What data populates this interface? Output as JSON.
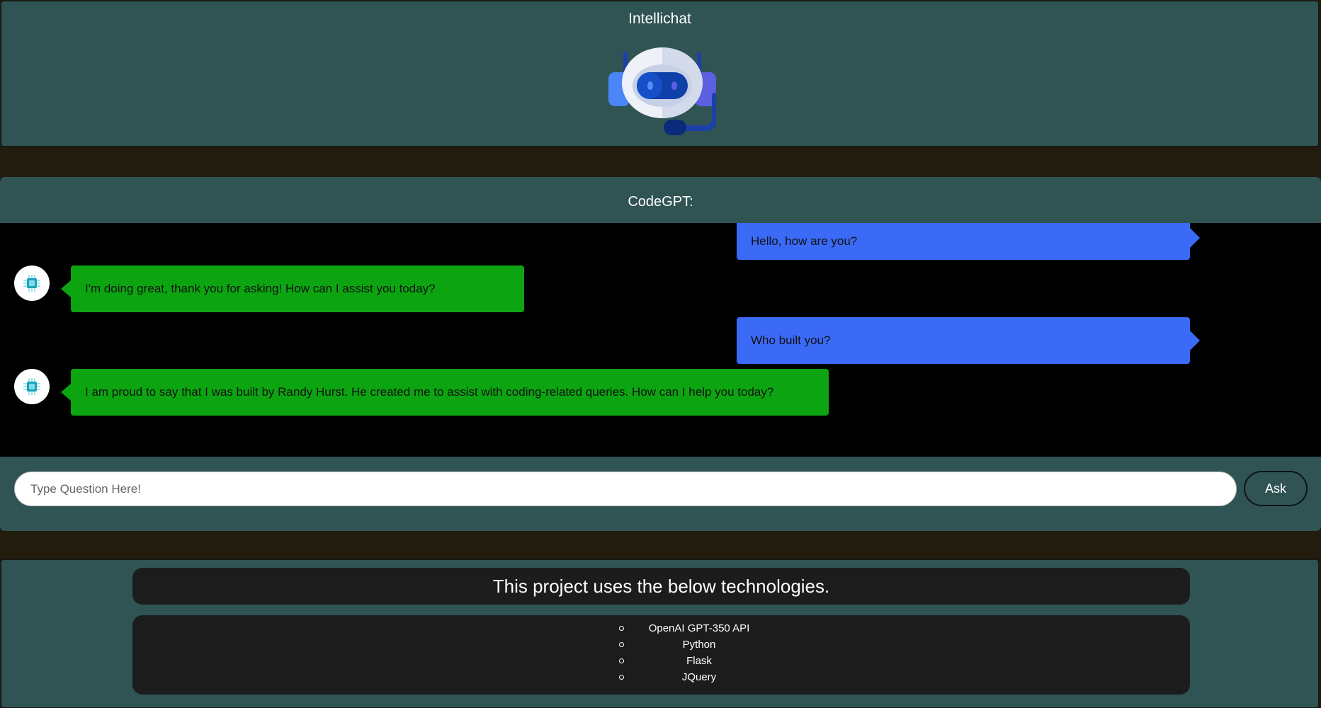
{
  "header": {
    "title": "Intellichat",
    "logo_icon": "robot-headset-icon"
  },
  "chat": {
    "title": "CodeGPT:",
    "bot_avatar_icon": "chip-icon",
    "messages": [
      {
        "role": "user",
        "text": "Hello, how are you?"
      },
      {
        "role": "bot",
        "text": "I'm doing great, thank you for asking! How can I assist you today?"
      },
      {
        "role": "user",
        "text": "Who built you?"
      },
      {
        "role": "bot",
        "text": "I am proud to say that I was built by Randy Hurst. He created me to assist with coding-related queries. How can I help you today?"
      }
    ],
    "input": {
      "placeholder": "Type Question Here!",
      "value": ""
    },
    "ask_label": "Ask"
  },
  "footer": {
    "heading": "This project uses the below technologies.",
    "technologies": [
      "OpenAI GPT-350 API",
      "Python",
      "Flask",
      "JQuery"
    ]
  },
  "colors": {
    "panel": "#305353",
    "page_background": "#221c0e",
    "chat_background": "#000000",
    "user_bubble": "#3a6af6",
    "bot_bubble": "#0ca511",
    "footer_box": "#1c1c1c"
  }
}
